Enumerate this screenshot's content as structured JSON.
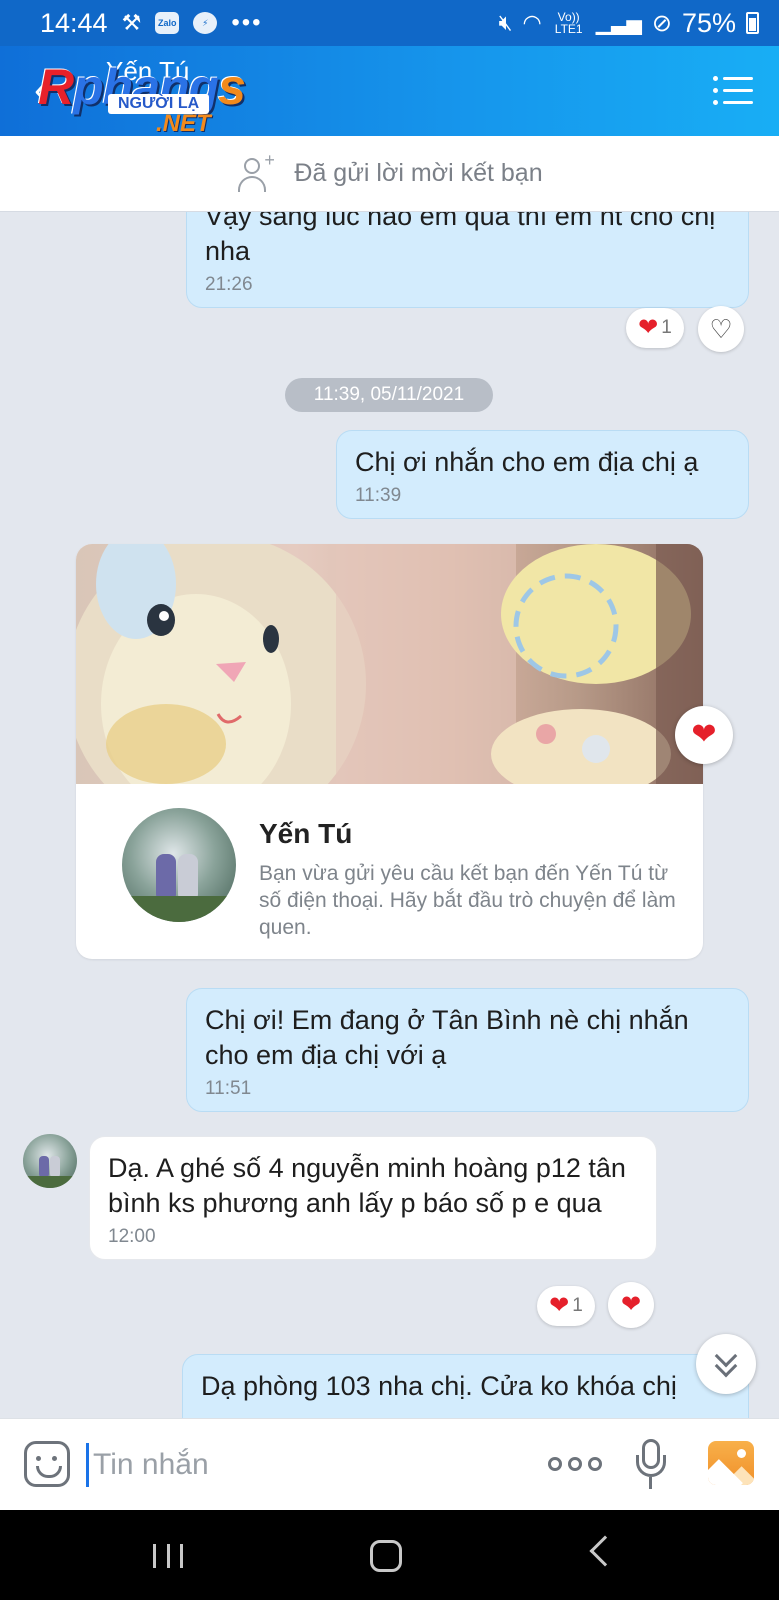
{
  "status_bar": {
    "time": "14:44",
    "dots": "•••",
    "zalo_label": "Zalo",
    "network_label": "Vo)) LTE1",
    "battery": "75%"
  },
  "header": {
    "contact_name": "Yến Tú",
    "logo": {
      "line1_a": "R",
      "line1_b": "phang",
      "line1_c": "s",
      "line2": "NGƯỜI LẠ",
      "line3": ".NET"
    }
  },
  "friend_request": {
    "label": "Đã gửi lời mời kết bạn"
  },
  "messages": [
    {
      "side": "mine",
      "text": "Vậy sáng lúc nào em qua thì em nt cho chị nha",
      "time": "21:26",
      "reaction_count": "1"
    },
    {
      "side": "mine",
      "text": "Chị ơi nhắn cho em địa chị ạ",
      "time": "11:39"
    },
    {
      "side": "mine",
      "text": "Chị ơi! Em đang ở Tân Bình nè chị nhắn cho em địa chị với ạ",
      "time": "11:51"
    },
    {
      "side": "theirs",
      "text": "Dạ. A ghé số 4 nguyễn minh hoàng p12 tân bình ks phương anh lấy p báo số p e qua",
      "time": "12:00",
      "reaction_count": "1"
    },
    {
      "side": "mine",
      "text": "Dạ phòng 103 nha chị. Cửa ko khóa chị"
    }
  ],
  "date_separator": "11:39, 05/11/2021",
  "profile_card": {
    "name": "Yến Tú",
    "description": "Bạn vừa gửi yêu cầu kết bạn đến Yến Tú từ số điện thoại. Hãy bắt đầu trò chuyện để làm quen."
  },
  "input": {
    "placeholder": "Tin nhắn"
  },
  "icons": {
    "heart_filled": "❤",
    "heart_outline": "♡",
    "back": "‹",
    "chevron_down": "⌄"
  },
  "colors": {
    "header_blue": "#1068c8",
    "my_bubble": "#d3ecfd",
    "their_bubble": "#ffffff",
    "chat_background": "#e3e7ee",
    "heart_red": "#e5202b"
  }
}
